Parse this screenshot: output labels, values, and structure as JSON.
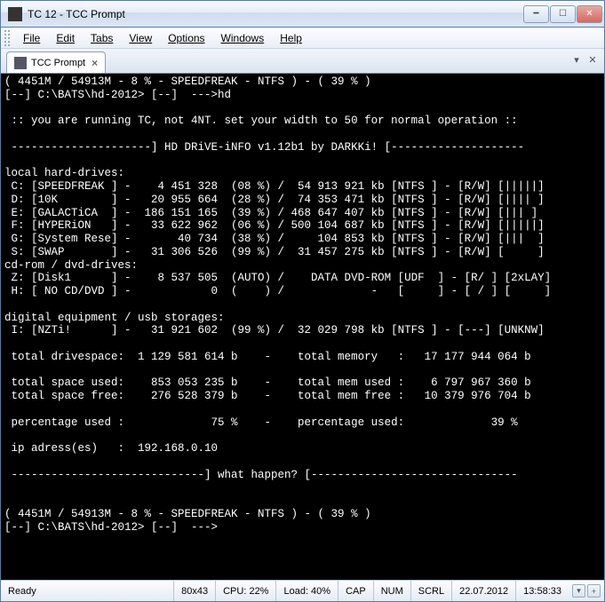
{
  "window": {
    "title": "TC 12 - TCC Prompt"
  },
  "menu": {
    "file": "File",
    "edit": "Edit",
    "tabs": "Tabs",
    "view": "View",
    "options": "Options",
    "windows": "Windows",
    "help": "Help"
  },
  "tab": {
    "label": "TCC Prompt"
  },
  "terminal": {
    "lines": [
      "( 4451M / 54913M - 8 % - SPEEDFREAK - NTFS ) - ( 39 % )",
      "[--] C:\\BATS\\hd-2012> [--]  --->hd",
      "",
      " :: you are running TC, not 4NT. set your width to 50 for normal operation ::",
      "",
      " ---------------------] HD DRiVE-iNFO v1.12b1 by DARKKi! [--------------------",
      "",
      "local hard-drives:",
      " C: [SPEEDFREAK ] -    4 451 328  (08 %) /  54 913 921 kb [NTFS ] - [R/W] [|||||]",
      " D: [10K        ] -   20 955 664  (28 %) /  74 353 471 kb [NTFS ] - [R/W] [|||| ]",
      " E: [GALACTiCA  ] -  186 151 165  (39 %) / 468 647 407 kb [NTFS ] - [R/W] [||| ]",
      " F: [HYPERiON   ] -   33 622 962  (06 %) / 500 104 687 kb [NTFS ] - [R/W] [|||||]",
      " G: [System Rese] -       40 734  (38 %) /     104 853 kb [NTFS ] - [R/W] [|||  ]",
      " S: [SWAP       ] -   31 306 526  (99 %) /  31 457 275 kb [NTFS ] - [R/W] [     ]",
      "cd-rom / dvd-drives:",
      " Z: [Disk1      ] -    8 537 505  (AUTO) /    DATA DVD-ROM [UDF  ] - [R/ ] [2xLAY]",
      " H: [ NO CD/DVD ] -            0  (    ) /             -   [     ] - [ / ] [     ]",
      "",
      "digital equipment / usb storages:",
      " I: [NZTi!      ] -   31 921 602  (99 %) /  32 029 798 kb [NTFS ] - [---] [UNKNW]",
      "",
      " total drivespace:  1 129 581 614 b    -    total memory   :   17 177 944 064 b",
      "",
      " total space used:    853 053 235 b    -    total mem used :    6 797 967 360 b",
      " total space free:    276 528 379 b    -    total mem free :   10 379 976 704 b",
      "",
      " percentage used :             75 %    -    percentage used:             39 %",
      "",
      " ip adress(es)   :  192.168.0.10",
      "",
      " -----------------------------] what happen? [-------------------------------",
      "",
      "",
      "( 4451M / 54913M - 8 % - SPEEDFREAK - NTFS ) - ( 39 % )",
      "[--] C:\\BATS\\hd-2012> [--]  --->"
    ]
  },
  "status": {
    "ready": "Ready",
    "dims": "80x43",
    "cpu": "CPU: 22%",
    "load": "Load: 40%",
    "cap": "CAP",
    "num": "NUM",
    "scrl": "SCRL",
    "date": "22.07.2012",
    "time": "13:58:33"
  }
}
